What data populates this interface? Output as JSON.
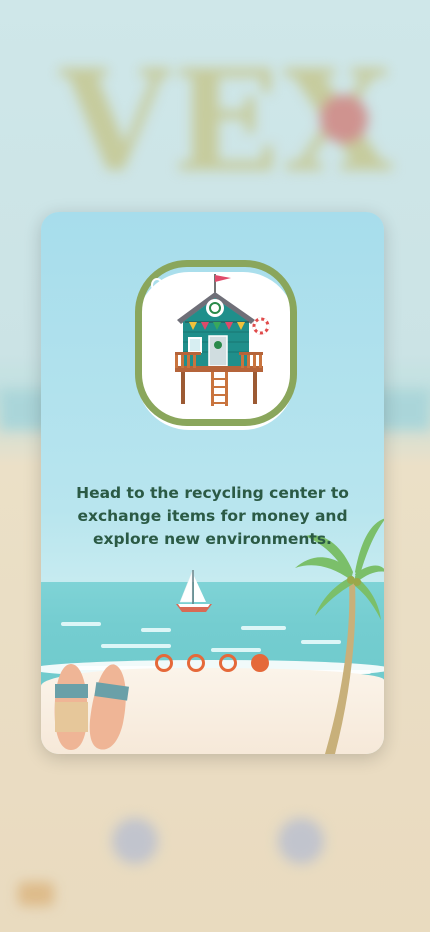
{
  "background": {
    "title": "VEX"
  },
  "card": {
    "description": "Head to the recycling center to exchange items for money and explore new environments.",
    "line1": "Head to the recycling center to",
    "line2": "exchange items for money and",
    "line3": "explore new environments.",
    "icon": "beach-hut-recycling-icon"
  },
  "pagination": {
    "total": 4,
    "active_index": 3
  },
  "colors": {
    "accent": "#e5693a",
    "text": "#2b5a45",
    "icon_ring": "#8aa65c"
  }
}
